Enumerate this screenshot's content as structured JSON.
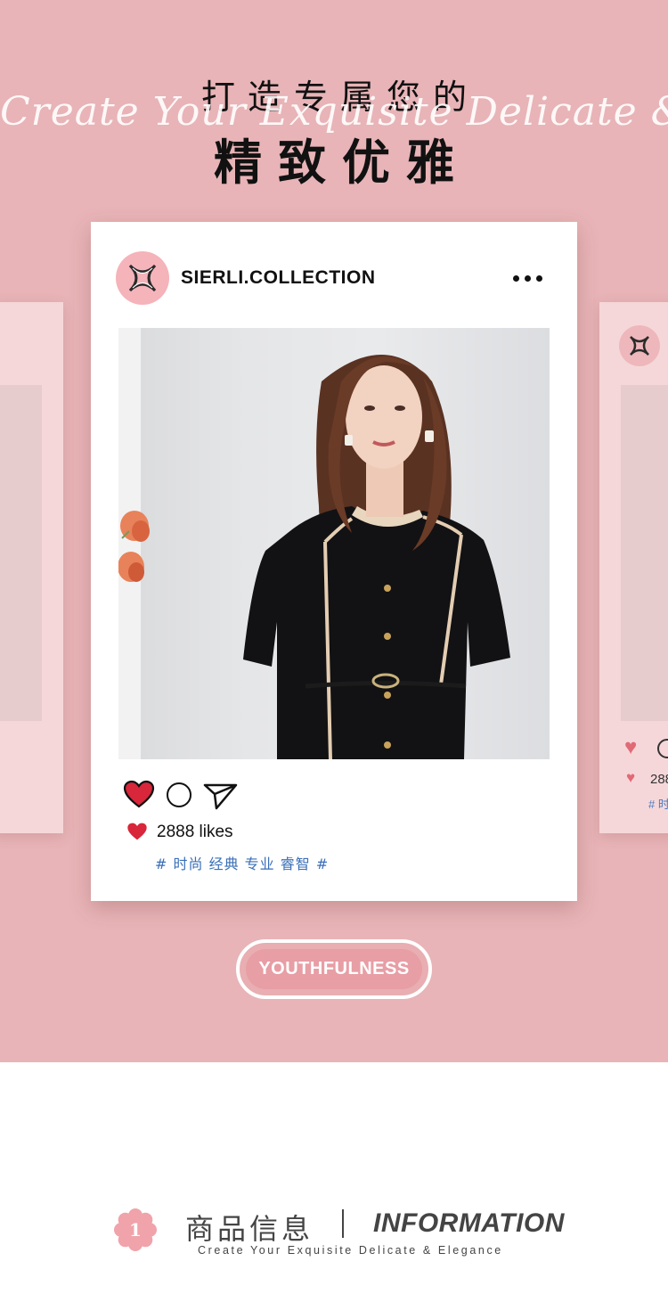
{
  "header": {
    "title_top": "打造专属您的",
    "script_line": "Create Your Exquisite Delicate & Elegance",
    "title_main": "精致优雅"
  },
  "post": {
    "username": "SIERLI.COLLECTION",
    "more_icon": "more-dots-icon",
    "likes": "2888 likes",
    "tags": "# 时尚 经典 专业 睿智 #",
    "icons": [
      "heart-icon",
      "comment-icon",
      "share-icon"
    ]
  },
  "side_card_right": {
    "likes_partial": "288",
    "tags_partial": "# 时"
  },
  "badge": {
    "label": "YOUTHFULNESS"
  },
  "info": {
    "number": "1",
    "title_cn": "商品信息",
    "title_en": "INFORMATION",
    "subtitle": "Create Your Exquisite Delicate & Elegance"
  },
  "colors": {
    "background_pink": "#e8b4b7",
    "card_white": "#ffffff",
    "heart_red": "#d8263a",
    "tag_blue": "#3a6fb8",
    "pill_pink": "#e79ea5"
  }
}
